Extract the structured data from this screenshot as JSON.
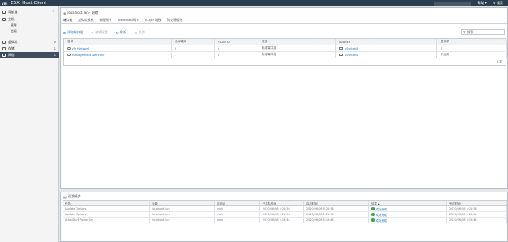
{
  "app": {
    "logo": "vm",
    "title": "ESXi Host Client"
  },
  "topbar": {
    "user_label": "帮助 ▾",
    "search_placeholder": "搜索"
  },
  "sidebar": {
    "items": [
      {
        "label": "导航器",
        "badge": ""
      },
      {
        "label": "主机",
        "badge": ""
      },
      {
        "label": "管理",
        "badge": ""
      },
      {
        "label": "监视",
        "badge": ""
      },
      {
        "label": "虚拟机",
        "badge": "0"
      },
      {
        "label": "存储",
        "badge": "1"
      },
      {
        "label": "网络",
        "badge": "1"
      }
    ]
  },
  "breadcrumb": {
    "text": "localhost.lan - 网络"
  },
  "tabs": [
    {
      "label": "端口组"
    },
    {
      "label": "虚拟交换机"
    },
    {
      "label": "物理网卡"
    },
    {
      "label": "VMkernel 网卡"
    },
    {
      "label": "TCP/IP 堆栈"
    },
    {
      "label": "防火墙规则"
    }
  ],
  "toolbar": {
    "add": "添加端口组",
    "edit": "编辑设置",
    "refresh": "刷新",
    "actions": "操作",
    "search_placeholder": "搜索"
  },
  "grid": {
    "columns": [
      "名称",
      "活动端口",
      "VLAN ID",
      "类型",
      "vSwitch",
      "虚拟机"
    ],
    "rows": [
      {
        "name": "VM Network",
        "active_ports": "0",
        "vlan": "0",
        "type": "标准端口组",
        "vswitch": "vSwitch0",
        "vms": "0"
      },
      {
        "name": "Management Network",
        "active_ports": "1",
        "vlan": "0",
        "type": "标准端口组",
        "vswitch": "vSwitch0",
        "vms": "不适用"
      }
    ],
    "footer": "2 项"
  },
  "tasks": {
    "title": "近期任务",
    "columns": [
      "任务",
      "对象",
      "启动者",
      "已排队时间",
      "启动时间",
      "结果 ▴",
      "完成时间 ▾"
    ],
    "rows": [
      {
        "task": "Update Options",
        "target": "localhost.lan",
        "initiator": "root",
        "queued": "2020/06/08 5:21:56",
        "started": "2020/06/08 5:21:56",
        "result": "成功完成",
        "completed": "2020/06/08 5:21:56"
      },
      {
        "task": "Update Options",
        "target": "localhost.lan",
        "initiator": "root",
        "queued": "2020/06/08 5:21:54",
        "started": "2020/06/08 5:21:54",
        "result": "成功完成",
        "completed": "2020/06/08 5:21:54"
      },
      {
        "task": "Auto Start Power On",
        "target": "localhost.lan",
        "initiator": "root",
        "queued": "2020/06/08 5:19:44",
        "started": "2020/06/08 5:19:44",
        "result": "成功完成",
        "completed": "2020/06/08 5:19:44"
      }
    ]
  },
  "colors": {
    "topbar": "#2b3e50",
    "accent": "#1b76c5",
    "success": "#3aa64a",
    "active_nav": "#3e4e60"
  }
}
